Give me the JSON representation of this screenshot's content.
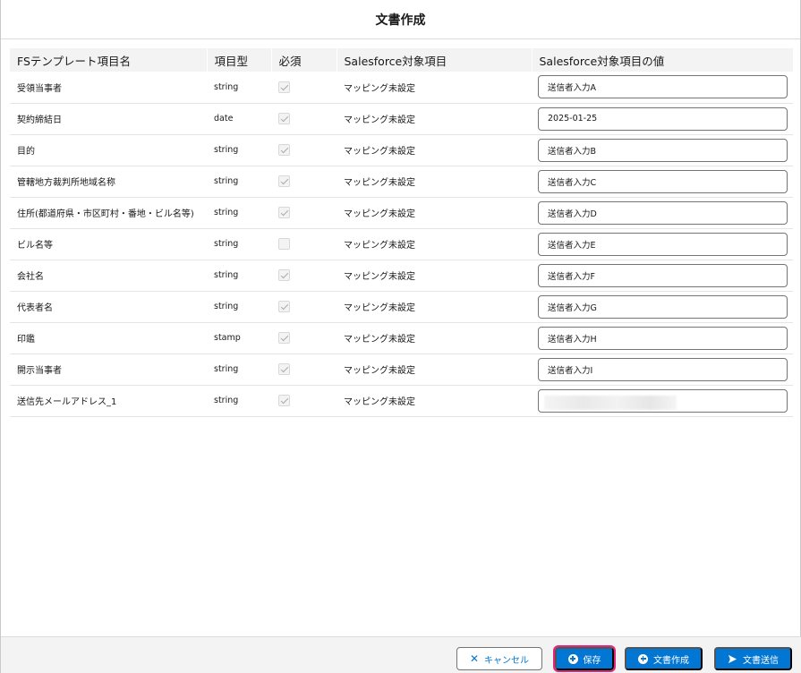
{
  "modal": {
    "title": "文書作成"
  },
  "table": {
    "headers": {
      "field_name": "FSテンプレート項目名",
      "type": "項目型",
      "required": "必須",
      "sf_field": "Salesforce対象項目",
      "sf_value": "Salesforce対象項目の値"
    },
    "rows": [
      {
        "name": "受領当事者",
        "type": "string",
        "required": true,
        "mapping": "マッピング未設定",
        "value": "送信者入力A"
      },
      {
        "name": "契約締結日",
        "type": "date",
        "required": true,
        "mapping": "マッピング未設定",
        "value": "2025-01-25"
      },
      {
        "name": "目的",
        "type": "string",
        "required": true,
        "mapping": "マッピング未設定",
        "value": "送信者入力B"
      },
      {
        "name": "管轄地方裁判所地域名称",
        "type": "string",
        "required": true,
        "mapping": "マッピング未設定",
        "value": "送信者入力C"
      },
      {
        "name": "住所(都道府県・市区町村・番地・ビル名等)",
        "type": "string",
        "required": true,
        "mapping": "マッピング未設定",
        "value": "送信者入力D"
      },
      {
        "name": "ビル名等",
        "type": "string",
        "required": false,
        "mapping": "マッピング未設定",
        "value": "送信者入力E"
      },
      {
        "name": "会社名",
        "type": "string",
        "required": true,
        "mapping": "マッピング未設定",
        "value": "送信者入力F"
      },
      {
        "name": "代表者名",
        "type": "string",
        "required": true,
        "mapping": "マッピング未設定",
        "value": "送信者入力G"
      },
      {
        "name": "印鑑",
        "type": "stamp",
        "required": true,
        "mapping": "マッピング未設定",
        "value": "送信者入力H"
      },
      {
        "name": "開示当事者",
        "type": "string",
        "required": true,
        "mapping": "マッピング未設定",
        "value": "送信者入力I"
      },
      {
        "name": "送信先メールアドレス_1",
        "type": "string",
        "required": true,
        "mapping": "マッピング未設定",
        "value": ""
      }
    ]
  },
  "footer": {
    "cancel_label": "キャンセル",
    "save_label": "保存",
    "create_label": "文書作成",
    "send_label": "文書送信"
  },
  "colors": {
    "brand": "#0176d3",
    "save_highlight": "#e0267a"
  },
  "icons": {
    "cancel": "close-icon",
    "save": "add-icon",
    "create": "add-icon",
    "send": "send-icon"
  }
}
